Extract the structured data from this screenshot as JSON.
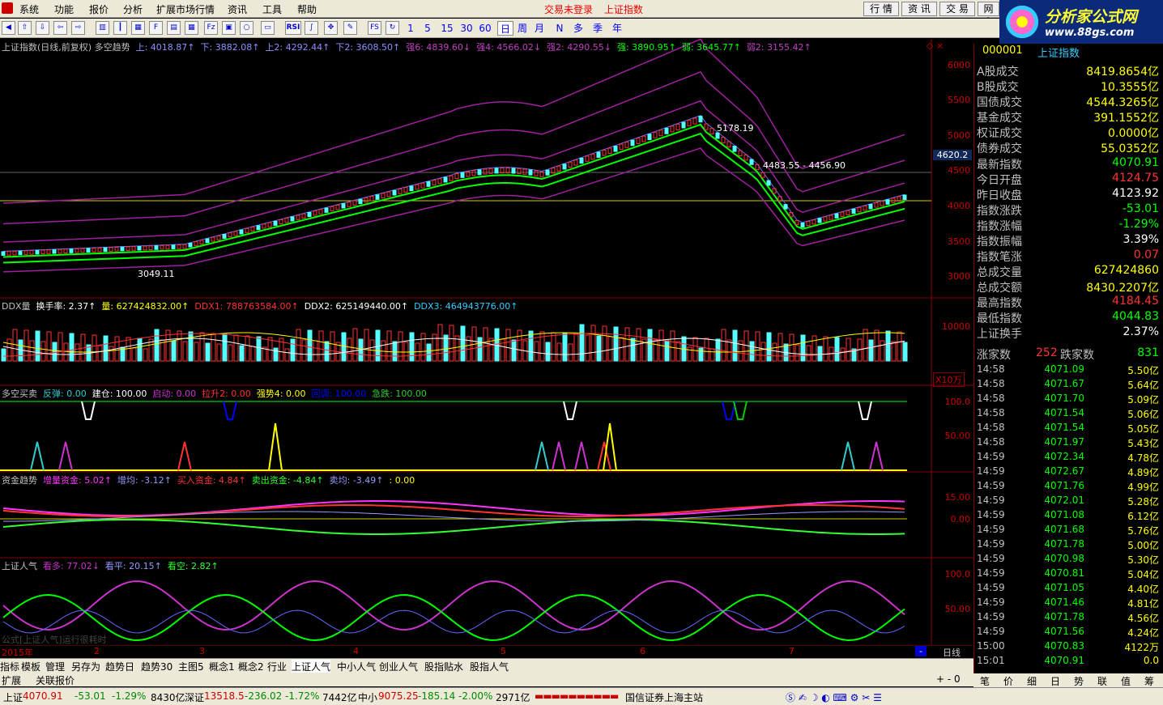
{
  "menu": [
    "系统",
    "功能",
    "报价",
    "分析",
    "扩展市场行情",
    "资讯",
    "工具",
    "帮助"
  ],
  "status_top": [
    "交易未登录",
    "上证指数"
  ],
  "top_buttons": [
    "行 情",
    "资 讯",
    "交 易",
    "网 上"
  ],
  "brand": {
    "name": "分析家公式网",
    "url": "www.88gs.com"
  },
  "periods": [
    "1",
    "5",
    "15",
    "30",
    "60",
    "日",
    "周",
    "月",
    "N",
    "多",
    "季",
    "年"
  ],
  "panel1": {
    "title": "上证指数(日线,前复权) 多空趋势",
    "items": [
      {
        "t": "上: 4018.87↑",
        "c": "#9090ff"
      },
      {
        "t": "下: 3882.08↑",
        "c": "#9090ff"
      },
      {
        "t": "上2: 4292.44↑",
        "c": "#9090ff"
      },
      {
        "t": "下2: 3608.50↑",
        "c": "#9090ff"
      },
      {
        "t": "强6: 4839.60↓",
        "c": "#c040c0"
      },
      {
        "t": "强4: 4566.02↓",
        "c": "#c040c0"
      },
      {
        "t": "强2: 4290.55↓",
        "c": "#c040c0"
      },
      {
        "t": "强: 3890.95↑",
        "c": "#00ff00"
      },
      {
        "t": "弱: 3645.77↑",
        "c": "#00ff00"
      },
      {
        "t": "弱2: 3155.42↑",
        "c": "#c040c0"
      }
    ],
    "axis": [
      "6000",
      "5500",
      "5000",
      "4500",
      "4000",
      "3500",
      "3000"
    ],
    "price_label": "4620.2",
    "annotations": [
      "5178.19",
      "4483.55 - 4456.90",
      "3049.11"
    ]
  },
  "panel2": {
    "title": "DDX量",
    "items": [
      {
        "t": "换手率: 2.37↑",
        "c": "#fff"
      },
      {
        "t": "量: 627424832.00↑",
        "c": "#ff0"
      },
      {
        "t": "DDX1: 788763584.00↑",
        "c": "#f33"
      },
      {
        "t": "DDX2: 625149440.00↑",
        "c": "#fff"
      },
      {
        "t": "DDX3: 464943776.00↑",
        "c": "#3cf"
      }
    ],
    "axis": [
      "10000"
    ],
    "unit": "X10万"
  },
  "panel3": {
    "title": "多空买卖",
    "items": [
      {
        "t": "反弹: 0.00",
        "c": "#3cc"
      },
      {
        "t": "建仓: 100.00",
        "c": "#fff"
      },
      {
        "t": "启动: 0.00",
        "c": "#c3c"
      },
      {
        "t": "拉升2: 0.00",
        "c": "#f33"
      },
      {
        "t": "强势4: 0.00",
        "c": "#ff0"
      },
      {
        "t": "回调: 100.00",
        "c": "#00f"
      },
      {
        "t": "急跌: 100.00",
        "c": "#3c3"
      }
    ],
    "axis": [
      "100.0",
      "50.00"
    ]
  },
  "panel4": {
    "title": "资金趋势",
    "items": [
      {
        "t": "增量资金: 5.02↑",
        "c": "#f3f"
      },
      {
        "t": "增均: -3.12↑",
        "c": "#99f"
      },
      {
        "t": "买入资金: 4.84↑",
        "c": "#f33"
      },
      {
        "t": "卖出资金: -4.84↑",
        "c": "#3f3"
      },
      {
        "t": "卖均: -3.49↑",
        "c": "#99f"
      },
      {
        "t": ": 0.00",
        "c": "#ff0"
      }
    ],
    "axis": [
      "15.00",
      "0.00"
    ]
  },
  "panel5": {
    "title": "上证人气",
    "items": [
      {
        "t": "看多: 77.02↓",
        "c": "#c3c"
      },
      {
        "t": "看平: 20.15↑",
        "c": "#99f"
      },
      {
        "t": "看空: 2.82↑",
        "c": "#3f3"
      }
    ],
    "axis": [
      "100.0",
      "50.00"
    ],
    "note": "公式[上证人气]运行很耗时"
  },
  "dates": [
    "2015年",
    "2",
    "3",
    "4",
    "5",
    "6",
    "7"
  ],
  "day_label": "日线",
  "tabs": [
    "指标",
    "模板",
    "管理",
    "另存为",
    "趋势日",
    "趋势30",
    "主图5",
    "概念1",
    "概念2",
    "行业",
    "上证人气",
    "中小人气",
    "创业人气",
    "股指贴水",
    "股指人气"
  ],
  "tab_active": "上证人气",
  "tabs2": [
    "扩展",
    "关联报价"
  ],
  "right": {
    "code": "000001",
    "name": "上证指数",
    "stats": [
      {
        "k": "A股成交",
        "v": "8419.8654亿",
        "c": "#ff0"
      },
      {
        "k": "B股成交",
        "v": "10.3555亿",
        "c": "#ff0"
      },
      {
        "k": "国债成交",
        "v": "4544.3265亿",
        "c": "#ff0"
      },
      {
        "k": "基金成交",
        "v": "391.1552亿",
        "c": "#ff0"
      },
      {
        "k": "权证成交",
        "v": "0.0000亿",
        "c": "#ff0"
      },
      {
        "k": "债券成交",
        "v": "55.0352亿",
        "c": "#ff0"
      },
      {
        "k": "最新指数",
        "v": "4070.91",
        "c": "#0f0"
      },
      {
        "k": "今日开盘",
        "v": "4124.75",
        "c": "#f33"
      },
      {
        "k": "昨日收盘",
        "v": "4123.92",
        "c": "#fff"
      },
      {
        "k": "指数涨跌",
        "v": "-53.01",
        "c": "#0f0"
      },
      {
        "k": "指数涨幅",
        "v": "-1.29%",
        "c": "#0f0"
      },
      {
        "k": "指数振幅",
        "v": "3.39%",
        "c": "#fff"
      },
      {
        "k": "指数笔涨",
        "v": "0.07",
        "c": "#f33"
      },
      {
        "k": "总成交量",
        "v": "627424860",
        "c": "#ff0"
      },
      {
        "k": "总成交额",
        "v": "8430.2207亿",
        "c": "#ff0"
      },
      {
        "k": "最高指数",
        "v": "4184.45",
        "c": "#f33"
      },
      {
        "k": "最低指数",
        "v": "4044.83",
        "c": "#0f0"
      },
      {
        "k": "上证换手",
        "v": "2.37%",
        "c": "#fff"
      }
    ],
    "up_label": "涨家数",
    "up": "252",
    "down_label": "跌家数",
    "down": "831",
    "ticks": [
      [
        "14:58",
        "4071.09",
        "5.50亿"
      ],
      [
        "14:58",
        "4071.67",
        "5.64亿"
      ],
      [
        "14:58",
        "4071.70",
        "5.09亿"
      ],
      [
        "14:58",
        "4071.54",
        "5.06亿"
      ],
      [
        "14:58",
        "4071.54",
        "5.05亿"
      ],
      [
        "14:58",
        "4071.97",
        "5.43亿"
      ],
      [
        "14:59",
        "4072.34",
        "4.78亿"
      ],
      [
        "14:59",
        "4072.67",
        "4.89亿"
      ],
      [
        "14:59",
        "4071.76",
        "4.99亿"
      ],
      [
        "14:59",
        "4072.01",
        "5.28亿"
      ],
      [
        "14:59",
        "4071.08",
        "6.12亿"
      ],
      [
        "14:59",
        "4071.68",
        "5.76亿"
      ],
      [
        "14:59",
        "4071.78",
        "5.00亿"
      ],
      [
        "14:59",
        "4070.98",
        "5.30亿"
      ],
      [
        "14:59",
        "4070.81",
        "5.04亿"
      ],
      [
        "14:59",
        "4071.05",
        "4.40亿"
      ],
      [
        "14:59",
        "4071.46",
        "4.81亿"
      ],
      [
        "14:59",
        "4071.78",
        "4.56亿"
      ],
      [
        "14:59",
        "4071.56",
        "4.24亿"
      ],
      [
        "15:00",
        "4070.83",
        "4122万"
      ],
      [
        "15:01",
        "4070.91",
        "0.0"
      ]
    ],
    "tabs": [
      "笔",
      "价",
      "细",
      "日",
      "势",
      "联",
      "值",
      "筹"
    ]
  },
  "statusbar": {
    "sh": "上证",
    "sh_v": "4070.91",
    "sh_c": "-53.01",
    "sh_p": "-1.29%",
    "sh_a": "8430亿",
    "sz": "深证",
    "sz_v": "13518.5",
    "sz_c": "-236.02",
    "sz_p": "-1.72%",
    "sz_a": "7442亿",
    "zx": "中小",
    "zx_v": "9075.25",
    "zx_c": "-185.14",
    "zx_p": "-2.00%",
    "zx_a": "2971亿",
    "broker": "国信证券上海主站"
  }
}
